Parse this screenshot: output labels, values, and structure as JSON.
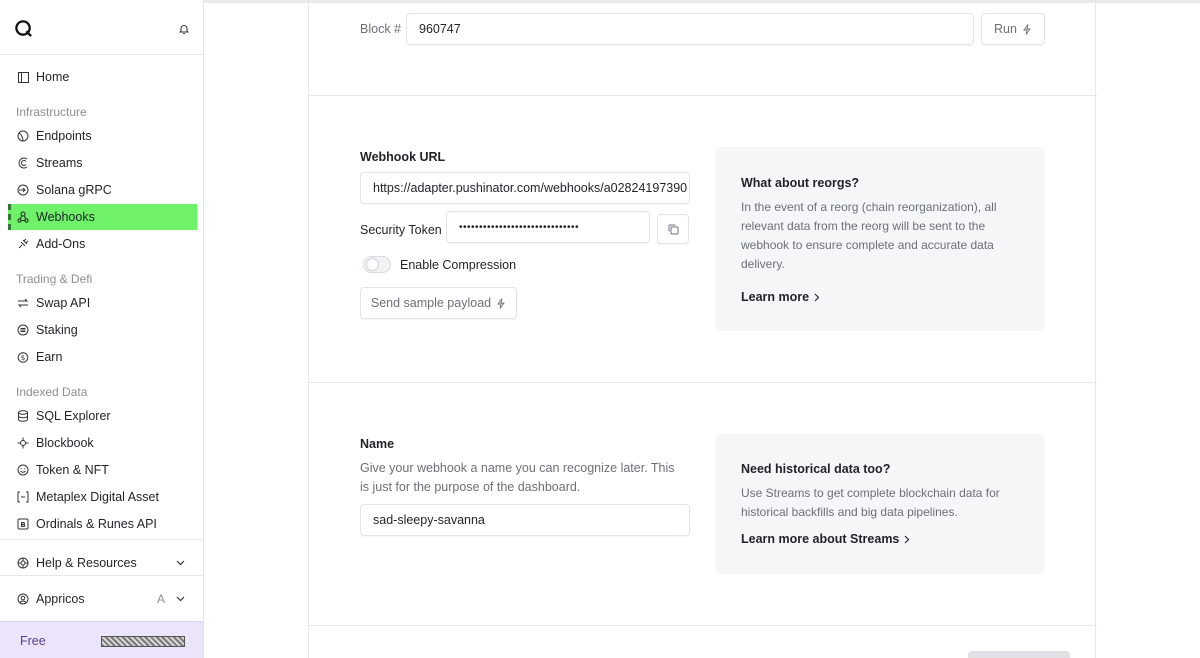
{
  "sidebar": {
    "home": "Home",
    "sections": {
      "infrastructure": "Infrastructure",
      "trading": "Trading & Defi",
      "indexed": "Indexed Data"
    },
    "items": [
      {
        "label": "Endpoints",
        "icon": "endpoints-icon"
      },
      {
        "label": "Streams",
        "icon": "streams-icon"
      },
      {
        "label": "Solana gRPC",
        "icon": "grpc-icon"
      },
      {
        "label": "Webhooks",
        "icon": "webhooks-icon",
        "active": true
      },
      {
        "label": "Add-Ons",
        "icon": "addons-icon"
      },
      {
        "label": "Swap API",
        "icon": "swap-icon"
      },
      {
        "label": "Staking",
        "icon": "staking-icon"
      },
      {
        "label": "Earn",
        "icon": "earn-icon"
      },
      {
        "label": "SQL Explorer",
        "icon": "database-icon"
      },
      {
        "label": "Blockbook",
        "icon": "blockbook-icon"
      },
      {
        "label": "Token & NFT",
        "icon": "token-icon"
      },
      {
        "label": "Metaplex Digital Asset",
        "icon": "metaplex-icon"
      },
      {
        "label": "Ordinals & Runes API",
        "icon": "ordinals-icon"
      }
    ],
    "help": "Help & Resources",
    "account": {
      "name": "Appricos",
      "letter": "A"
    },
    "plan": "Free",
    "accent": "#6ff26a"
  },
  "block": {
    "label": "Block #",
    "value": "960747",
    "run_label": "Run"
  },
  "webhook": {
    "url_label": "Webhook URL",
    "url_value": "https://adapter.pushinator.com/webhooks/a02824197390",
    "token_label": "Security Token",
    "token_value": "••••••••••••••••••••••••••••••",
    "compression_label": "Enable Compression",
    "send_sample_label": "Send sample payload"
  },
  "reorg_info": {
    "title": "What about reorgs?",
    "body": "In the event of a reorg (chain reorganization), all relevant data from the reorg will be sent to the webhook to ensure complete and accurate data delivery.",
    "link": "Learn more"
  },
  "name_section": {
    "label": "Name",
    "description": "Give your webhook a name you can recognize later. This is just for the purpose of the dashboard.",
    "value": "sad-sleepy-savanna"
  },
  "historical_info": {
    "title": "Need historical data too?",
    "body": "Use Streams to get complete blockchain data for historical backfills and big data pipelines.",
    "link": "Learn more about Streams"
  }
}
